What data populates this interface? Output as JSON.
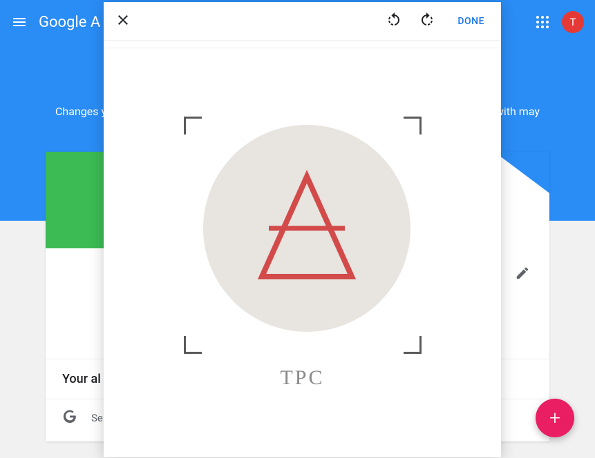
{
  "header": {
    "logo_text": "Google A",
    "avatar_initial": "T"
  },
  "page": {
    "info_text_left": "Changes y",
    "info_text_right": "with may",
    "albums_title": "Your al",
    "albums_row_text": "Se"
  },
  "modal": {
    "done_label": "DONE",
    "caption": "TPC"
  },
  "fab": {
    "plus": "+"
  }
}
